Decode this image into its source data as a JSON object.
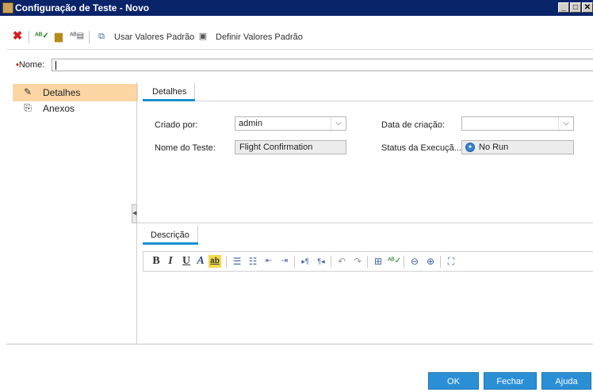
{
  "window": {
    "title": "Configuração de Teste - Novo",
    "minimize_glyph": "_",
    "maximize_glyph": "□",
    "close_glyph": "✕"
  },
  "toolbar": {
    "use_defaults_label": "Usar Valores Padrão",
    "set_defaults_label": "Definir Valores Padrão"
  },
  "name_field": {
    "label": "Nome:",
    "required_marker": "•",
    "value": ""
  },
  "sidebar": {
    "items": [
      {
        "label": "Detalhes",
        "icon": "details-icon",
        "selected": true
      },
      {
        "label": "Anexos",
        "icon": "paperclip-icon",
        "selected": false
      }
    ]
  },
  "details_tab": {
    "label": "Detalhes"
  },
  "form": {
    "created_by_label": "Criado por:",
    "created_by_value": "admin",
    "creation_date_label": "Data de criação:",
    "creation_date_value": "",
    "test_name_label": "Nome do Teste:",
    "test_name_value": "Flight Confirmation",
    "exec_status_label": "Status da Execuçã...",
    "exec_status_value": "No Run"
  },
  "description_tab": {
    "label": "Descrição"
  },
  "editor_toolbar": {
    "bold": "B",
    "italic": "I",
    "underline": "U",
    "font_color": "A"
  },
  "buttons": {
    "ok": "OK",
    "close": "Fechar",
    "help": "Ajuda"
  },
  "colors": {
    "title_bar": "#0a246a",
    "selection": "#fbd6a4",
    "accent": "#1a8fd1",
    "button": "#2b8fd6"
  }
}
